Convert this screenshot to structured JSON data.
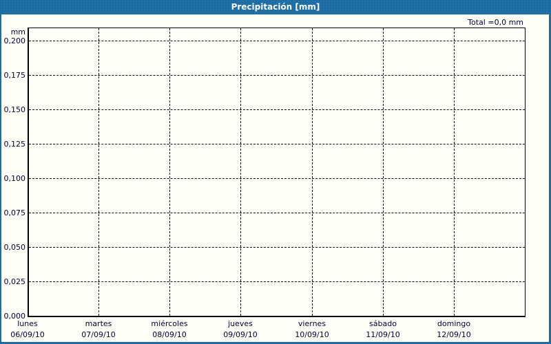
{
  "titlebar": {
    "title": "Precipitación [mm]"
  },
  "summary": {
    "total": "Total =0,0 mm"
  },
  "colors": {
    "titlebar_bg": "#1d6ca3",
    "window_border": "#1d6ca3",
    "page_bg": "#fffef7",
    "grid_line": "#000000",
    "label_text": "#000033",
    "title_text": "#ffffff"
  },
  "chart_data": {
    "type": "bar",
    "title": "Precipitación [mm]",
    "ylabel": "mm",
    "xlabel": "",
    "ylim": [
      0,
      0.21
    ],
    "grid": "dashed-both-axes",
    "legend_position": "none",
    "total_annotation": "Total =0,0 mm",
    "y_ticks": [
      {
        "label": "0,200",
        "value": 0.2
      },
      {
        "label": "0,175",
        "value": 0.175
      },
      {
        "label": "0,150",
        "value": 0.15
      },
      {
        "label": "0,125",
        "value": 0.125
      },
      {
        "label": "0,100",
        "value": 0.1
      },
      {
        "label": "0,075",
        "value": 0.075
      },
      {
        "label": "0,050",
        "value": 0.05
      },
      {
        "label": "0,025",
        "value": 0.025
      },
      {
        "label": "0,000",
        "value": 0.0
      }
    ],
    "categories": [
      "lunes",
      "martes",
      "miércoles",
      "jueves",
      "viernes",
      "sábado",
      "domingo"
    ],
    "x_ticks": [
      {
        "day": "lunes",
        "date": "06/09/10"
      },
      {
        "day": "martes",
        "date": "07/09/10"
      },
      {
        "day": "miércoles",
        "date": "08/09/10"
      },
      {
        "day": "jueves",
        "date": "09/09/10"
      },
      {
        "day": "viernes",
        "date": "10/09/10"
      },
      {
        "day": "sábado",
        "date": "11/09/10"
      },
      {
        "day": "domingo",
        "date": "12/09/10"
      }
    ],
    "series": [
      {
        "name": "Precipitación",
        "values": [
          0,
          0,
          0,
          0,
          0,
          0,
          0
        ]
      }
    ],
    "total_value_mm": 0.0
  }
}
